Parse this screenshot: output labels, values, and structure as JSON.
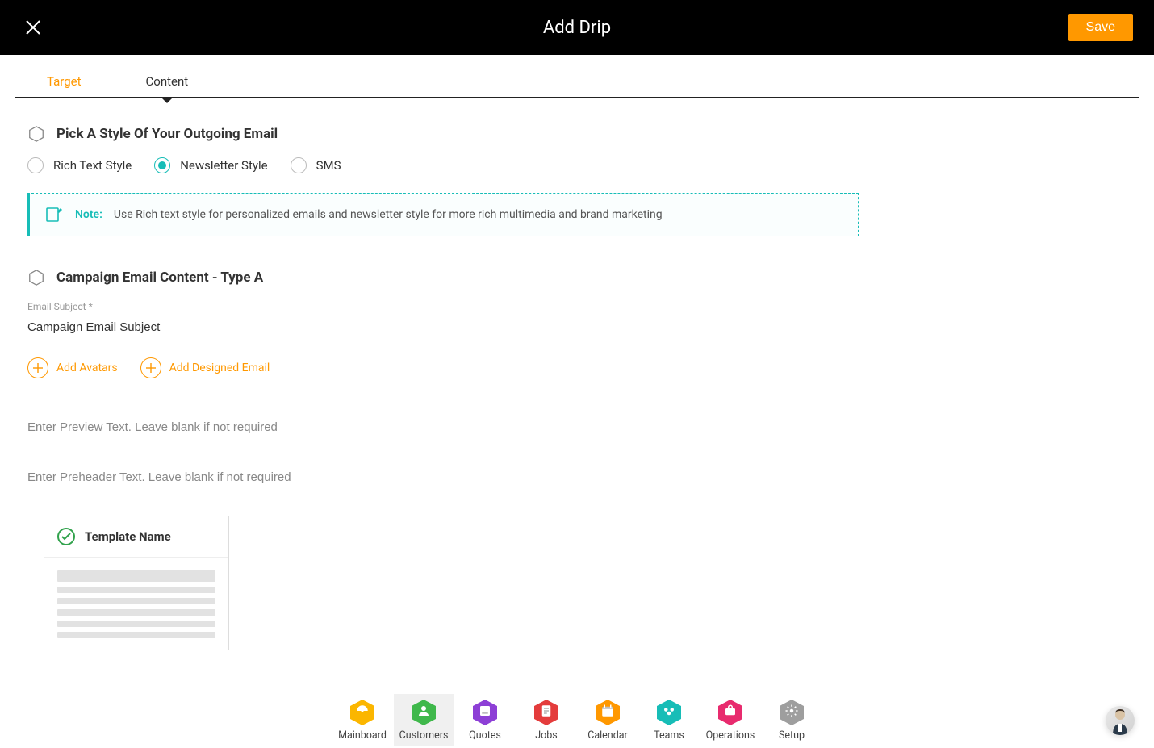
{
  "header": {
    "title": "Add Drip",
    "save_label": "Save"
  },
  "tabs": {
    "target": "Target",
    "content": "Content",
    "active": "target",
    "caret_on": "content"
  },
  "style_section": {
    "heading": "Pick A Style Of Your Outgoing Email",
    "options": {
      "rich": "Rich Text Style",
      "newsletter": "Newsletter Style",
      "sms": "SMS"
    },
    "selected": "newsletter"
  },
  "note": {
    "label": "Note:",
    "text": "Use Rich text style for personalized emails and newsletter style for more rich multimedia and brand marketing"
  },
  "campaign_section": {
    "heading": "Campaign Email Content - Type A",
    "subject_label": "Email Subject *",
    "subject_value": "Campaign Email Subject",
    "add_avatars": "Add Avatars",
    "add_designed_email": "Add Designed Email",
    "preview_placeholder": "Enter Preview Text. Leave blank if not required",
    "preheader_placeholder": "Enter Preheader Text. Leave blank if not required"
  },
  "template": {
    "name": "Template Name"
  },
  "nav": {
    "items": [
      {
        "label": "Mainboard",
        "color": "#fbb600",
        "icon": "mainboard"
      },
      {
        "label": "Customers",
        "color": "#3fb84b",
        "icon": "customers",
        "active": true
      },
      {
        "label": "Quotes",
        "color": "#8d3fd6",
        "icon": "quotes"
      },
      {
        "label": "Jobs",
        "color": "#e43c3c",
        "icon": "jobs"
      },
      {
        "label": "Calendar",
        "color": "#ff9800",
        "icon": "calendar"
      },
      {
        "label": "Teams",
        "color": "#17bdb7",
        "icon": "teams"
      },
      {
        "label": "Operations",
        "color": "#e82b6e",
        "icon": "operations"
      },
      {
        "label": "Setup",
        "color": "#9e9e9e",
        "icon": "setup"
      }
    ]
  }
}
